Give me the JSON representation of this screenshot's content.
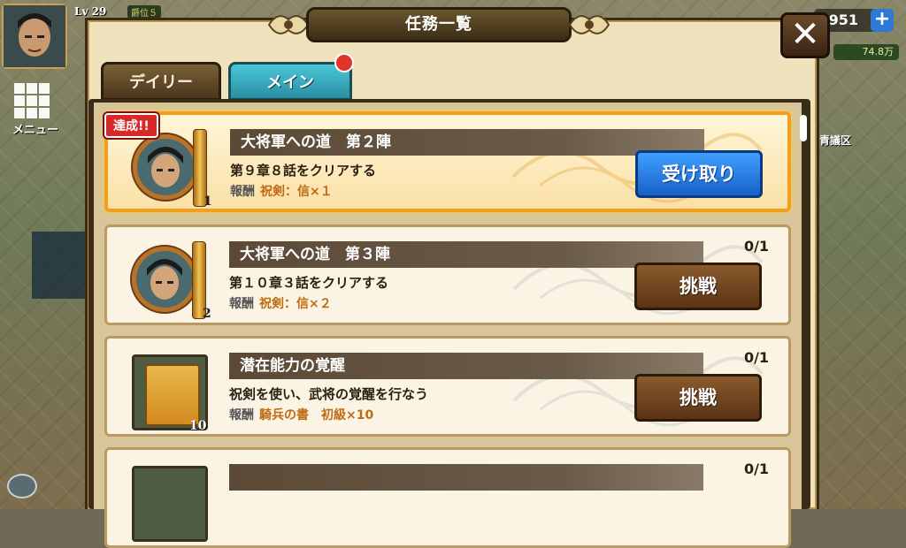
{
  "hud": {
    "level": "Lv 29",
    "rank_badge": "爵位５",
    "menu_label": "メニュー",
    "coins": "951",
    "coins_sub": "74.8万",
    "right_label": "青議区"
  },
  "dialog": {
    "title": "任務一覧",
    "close_symbol": "✕"
  },
  "tabs": [
    {
      "label": "デイリー",
      "active": false
    },
    {
      "label": "メイン",
      "active": true
    }
  ],
  "missions": [
    {
      "title": "大将軍への道　第２陣",
      "description": "第９章８話をクリアする",
      "reward_label": "報酬",
      "reward": "祝剣：信×１",
      "icon_count": "1",
      "achieved_label": "達成!!",
      "progress": "",
      "button_label": "受け取り",
      "status": "achieved"
    },
    {
      "title": "大将軍への道　第３陣",
      "description": "第１０章３話をクリアする",
      "reward_label": "報酬",
      "reward": "祝剣：信×２",
      "icon_count": "2",
      "progress": "0/1",
      "button_label": "挑戦",
      "status": "open"
    },
    {
      "title": "潜在能力の覚醒",
      "description": "祝剣を使い、武将の覚醒を行なう",
      "reward_label": "報酬",
      "reward": "騎兵の書　初級×10",
      "icon_count": "10",
      "progress": "0/1",
      "button_label": "挑戦",
      "status": "open"
    },
    {
      "title": "",
      "description": "",
      "progress": "0/1",
      "status": "partial"
    }
  ],
  "colors": {
    "accent_tab": "#2b8ea4",
    "claim_button": "#1760c8",
    "challenge_button": "#5a3414",
    "reward_text": "#c06a12",
    "achieved_badge": "#d92828"
  }
}
